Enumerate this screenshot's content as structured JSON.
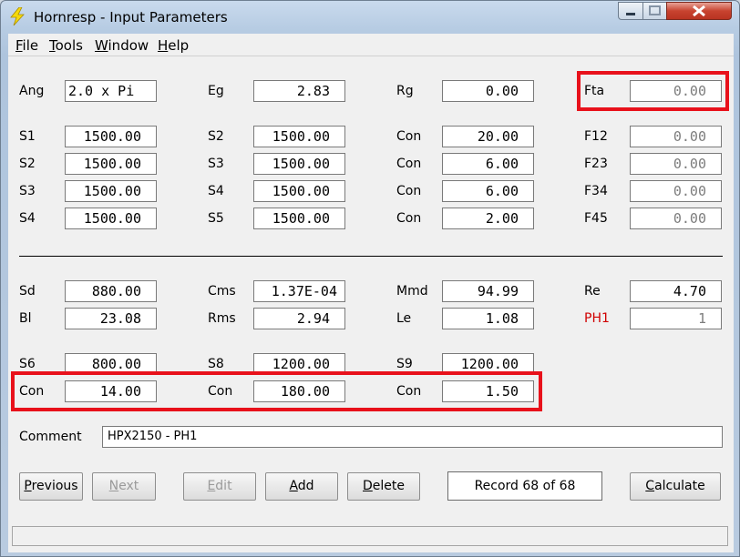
{
  "window": {
    "title": "Hornresp - Input Parameters"
  },
  "menu": [
    {
      "key": "F",
      "rest": "ile"
    },
    {
      "key": "T",
      "rest": "ools"
    },
    {
      "key": "W",
      "rest": "indow"
    },
    {
      "key": "H",
      "rest": "elp"
    }
  ],
  "row_ang": {
    "ang": {
      "label": "Ang",
      "value": "2.0 x Pi"
    },
    "eg": {
      "label": "Eg",
      "value": "2.83"
    },
    "rg": {
      "label": "Rg",
      "value": "0.00"
    },
    "fta": {
      "label": "Fta",
      "value": "0.00"
    }
  },
  "horn_rows": [
    {
      "a_label": "S1",
      "a_value": "1500.00",
      "b_label": "S2",
      "b_value": "1500.00",
      "c_label": "Con",
      "c_value": "20.00",
      "d_label": "F12",
      "d_value": "0.00"
    },
    {
      "a_label": "S2",
      "a_value": "1500.00",
      "b_label": "S3",
      "b_value": "1500.00",
      "c_label": "Con",
      "c_value": "6.00",
      "d_label": "F23",
      "d_value": "0.00"
    },
    {
      "a_label": "S3",
      "a_value": "1500.00",
      "b_label": "S4",
      "b_value": "1500.00",
      "c_label": "Con",
      "c_value": "6.00",
      "d_label": "F34",
      "d_value": "0.00"
    },
    {
      "a_label": "S4",
      "a_value": "1500.00",
      "b_label": "S5",
      "b_value": "1500.00",
      "c_label": "Con",
      "c_value": "2.00",
      "d_label": "F45",
      "d_value": "0.00"
    }
  ],
  "driver_rows": [
    {
      "a_label": "Sd",
      "a_value": "880.00",
      "b_label": "Cms",
      "b_value": "1.37E-04",
      "c_label": "Mmd",
      "c_value": "94.99",
      "d_label": "Re",
      "d_value": "4.70"
    },
    {
      "a_label": "Bl",
      "a_value": "23.08",
      "b_label": "Rms",
      "b_value": "2.94",
      "c_label": "Le",
      "c_value": "1.08",
      "d_label": "PH1",
      "d_value": "1"
    }
  ],
  "chamber_s": {
    "s6_label": "S6",
    "s6_value": "800.00",
    "s8_label": "S8",
    "s8_value": "1200.00",
    "s9_label": "S9",
    "s9_value": "1200.00"
  },
  "chamber_con": {
    "label": "Con",
    "values": [
      "14.00",
      "180.00",
      "1.50"
    ]
  },
  "comment": {
    "label": "Comment",
    "value": "HPX2150 - PH1"
  },
  "buttons": {
    "previous": "Previous",
    "next": "Next",
    "edit": "Edit",
    "add": "Add",
    "delete": "Delete",
    "calculate": "Calculate"
  },
  "record": "Record 68 of 68",
  "colors": {
    "highlight": "#e8111b",
    "ph1_label": "#d00000"
  }
}
